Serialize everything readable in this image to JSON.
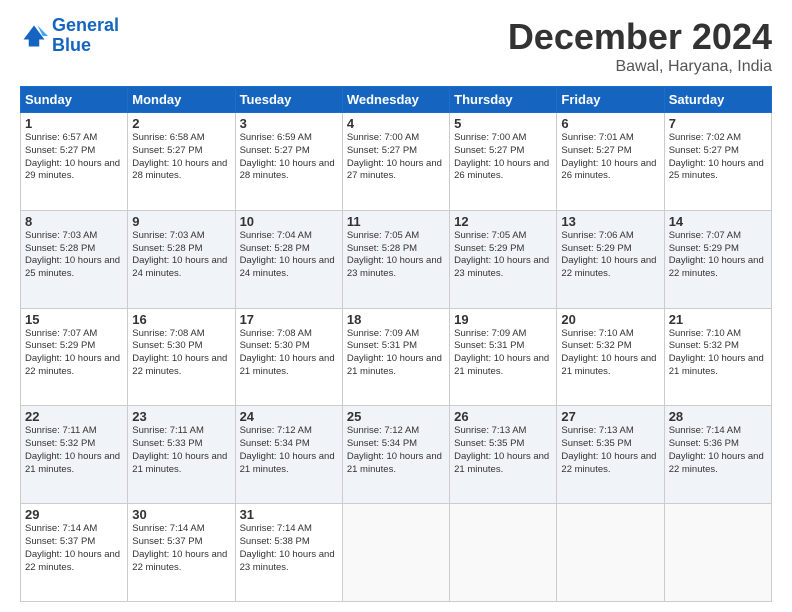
{
  "logo": {
    "line1": "General",
    "line2": "Blue"
  },
  "title": "December 2024",
  "location": "Bawal, Haryana, India",
  "days_of_week": [
    "Sunday",
    "Monday",
    "Tuesday",
    "Wednesday",
    "Thursday",
    "Friday",
    "Saturday"
  ],
  "weeks": [
    [
      {
        "day": "1",
        "sunrise": "6:57 AM",
        "sunset": "5:27 PM",
        "daylight": "10 hours and 29 minutes."
      },
      {
        "day": "2",
        "sunrise": "6:58 AM",
        "sunset": "5:27 PM",
        "daylight": "10 hours and 28 minutes."
      },
      {
        "day": "3",
        "sunrise": "6:59 AM",
        "sunset": "5:27 PM",
        "daylight": "10 hours and 28 minutes."
      },
      {
        "day": "4",
        "sunrise": "7:00 AM",
        "sunset": "5:27 PM",
        "daylight": "10 hours and 27 minutes."
      },
      {
        "day": "5",
        "sunrise": "7:00 AM",
        "sunset": "5:27 PM",
        "daylight": "10 hours and 26 minutes."
      },
      {
        "day": "6",
        "sunrise": "7:01 AM",
        "sunset": "5:27 PM",
        "daylight": "10 hours and 26 minutes."
      },
      {
        "day": "7",
        "sunrise": "7:02 AM",
        "sunset": "5:27 PM",
        "daylight": "10 hours and 25 minutes."
      }
    ],
    [
      {
        "day": "8",
        "sunrise": "7:03 AM",
        "sunset": "5:28 PM",
        "daylight": "10 hours and 25 minutes."
      },
      {
        "day": "9",
        "sunrise": "7:03 AM",
        "sunset": "5:28 PM",
        "daylight": "10 hours and 24 minutes."
      },
      {
        "day": "10",
        "sunrise": "7:04 AM",
        "sunset": "5:28 PM",
        "daylight": "10 hours and 24 minutes."
      },
      {
        "day": "11",
        "sunrise": "7:05 AM",
        "sunset": "5:28 PM",
        "daylight": "10 hours and 23 minutes."
      },
      {
        "day": "12",
        "sunrise": "7:05 AM",
        "sunset": "5:29 PM",
        "daylight": "10 hours and 23 minutes."
      },
      {
        "day": "13",
        "sunrise": "7:06 AM",
        "sunset": "5:29 PM",
        "daylight": "10 hours and 22 minutes."
      },
      {
        "day": "14",
        "sunrise": "7:07 AM",
        "sunset": "5:29 PM",
        "daylight": "10 hours and 22 minutes."
      }
    ],
    [
      {
        "day": "15",
        "sunrise": "7:07 AM",
        "sunset": "5:29 PM",
        "daylight": "10 hours and 22 minutes."
      },
      {
        "day": "16",
        "sunrise": "7:08 AM",
        "sunset": "5:30 PM",
        "daylight": "10 hours and 22 minutes."
      },
      {
        "day": "17",
        "sunrise": "7:08 AM",
        "sunset": "5:30 PM",
        "daylight": "10 hours and 21 minutes."
      },
      {
        "day": "18",
        "sunrise": "7:09 AM",
        "sunset": "5:31 PM",
        "daylight": "10 hours and 21 minutes."
      },
      {
        "day": "19",
        "sunrise": "7:09 AM",
        "sunset": "5:31 PM",
        "daylight": "10 hours and 21 minutes."
      },
      {
        "day": "20",
        "sunrise": "7:10 AM",
        "sunset": "5:32 PM",
        "daylight": "10 hours and 21 minutes."
      },
      {
        "day": "21",
        "sunrise": "7:10 AM",
        "sunset": "5:32 PM",
        "daylight": "10 hours and 21 minutes."
      }
    ],
    [
      {
        "day": "22",
        "sunrise": "7:11 AM",
        "sunset": "5:32 PM",
        "daylight": "10 hours and 21 minutes."
      },
      {
        "day": "23",
        "sunrise": "7:11 AM",
        "sunset": "5:33 PM",
        "daylight": "10 hours and 21 minutes."
      },
      {
        "day": "24",
        "sunrise": "7:12 AM",
        "sunset": "5:34 PM",
        "daylight": "10 hours and 21 minutes."
      },
      {
        "day": "25",
        "sunrise": "7:12 AM",
        "sunset": "5:34 PM",
        "daylight": "10 hours and 21 minutes."
      },
      {
        "day": "26",
        "sunrise": "7:13 AM",
        "sunset": "5:35 PM",
        "daylight": "10 hours and 21 minutes."
      },
      {
        "day": "27",
        "sunrise": "7:13 AM",
        "sunset": "5:35 PM",
        "daylight": "10 hours and 22 minutes."
      },
      {
        "day": "28",
        "sunrise": "7:14 AM",
        "sunset": "5:36 PM",
        "daylight": "10 hours and 22 minutes."
      }
    ],
    [
      {
        "day": "29",
        "sunrise": "7:14 AM",
        "sunset": "5:37 PM",
        "daylight": "10 hours and 22 minutes."
      },
      {
        "day": "30",
        "sunrise": "7:14 AM",
        "sunset": "5:37 PM",
        "daylight": "10 hours and 22 minutes."
      },
      {
        "day": "31",
        "sunrise": "7:14 AM",
        "sunset": "5:38 PM",
        "daylight": "10 hours and 23 minutes."
      },
      null,
      null,
      null,
      null
    ]
  ]
}
